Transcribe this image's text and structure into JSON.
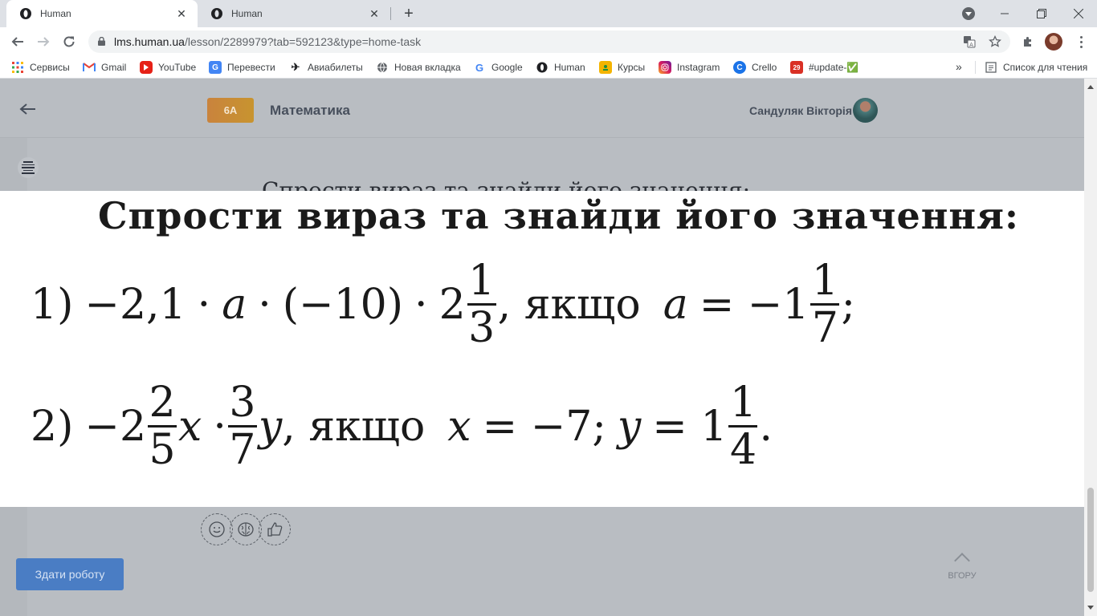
{
  "browser": {
    "tabs": [
      {
        "title": "Human",
        "active": true
      },
      {
        "title": "Human",
        "active": false
      }
    ],
    "url_host": "lms.human.ua",
    "url_path": "/lesson/2289979?tab=592123&type=home-task",
    "bookmarks": [
      {
        "label": "Сервисы",
        "icon": "apps-grid-icon"
      },
      {
        "label": "Gmail",
        "icon": "gmail-icon"
      },
      {
        "label": "YouTube",
        "icon": "youtube-icon"
      },
      {
        "label": "Перевести",
        "icon": "translate-icon"
      },
      {
        "label": "Авиабилеты",
        "icon": "plane-icon"
      },
      {
        "label": "Новая вкладка",
        "icon": "globe-icon"
      },
      {
        "label": "Google",
        "icon": "google-icon"
      },
      {
        "label": "Human",
        "icon": "human-icon"
      },
      {
        "label": "Курсы",
        "icon": "classroom-icon"
      },
      {
        "label": "Instagram",
        "icon": "instagram-icon"
      },
      {
        "label": "Crello",
        "icon": "crello-icon"
      },
      {
        "label": "#update-✅",
        "icon": "calendar-icon"
      }
    ],
    "reading_list": "Список для чтения",
    "calendar_badge": "29"
  },
  "page": {
    "class_badge": "6A",
    "subject": "Математика",
    "student_name": "Сандуляк Вікторія",
    "ghost_heading": "Спрости вираз та знайди його значення:",
    "task": {
      "title": "Спрости вираз та знайди його значення:",
      "p1": {
        "num": "1)",
        "a": "−2,1",
        "dot": "·",
        "var_a": "a",
        "neg10": "(−10)",
        "whole1": "2",
        "f1_num": "1",
        "f1_den": "3",
        "tail": ", якщо",
        "eq": "= −1",
        "f2_num": "1",
        "f2_den": "7",
        "end": ";"
      },
      "p2": {
        "num": "2)",
        "lead": "−2",
        "f1_num": "2",
        "f1_den": "5",
        "var_x": "x",
        "dot": "·",
        "f2_num": "3",
        "f2_den": "7",
        "var_y": "y",
        "tail": ", якщо",
        "x_eq": "= −7;",
        "y_eq": "= 1",
        "f3_num": "1",
        "f3_den": "4",
        "end": "."
      }
    },
    "reactions": [
      "emoji-face-icon",
      "brain-icon",
      "thumbs-up-icon"
    ],
    "submit_label": "Здати роботу",
    "up_label": "ВГОРУ"
  }
}
